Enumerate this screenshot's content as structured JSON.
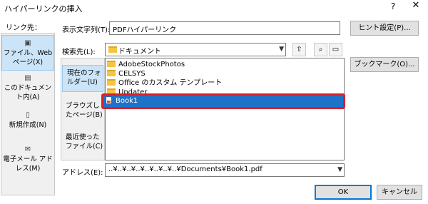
{
  "window": {
    "title": "ハイパーリンクの挿入",
    "help": "?",
    "close": "✕"
  },
  "link_to": {
    "label": "リンク先：",
    "items": [
      {
        "label": "ファイル、Web ページ(X)",
        "icon": "globe-file-icon",
        "selected": true
      },
      {
        "label": "このドキュメント内(A)",
        "icon": "document-anchor-icon",
        "selected": false
      },
      {
        "label": "新規作成(N)",
        "icon": "new-document-icon",
        "selected": false
      },
      {
        "label": "電子メール アドレス(M)",
        "icon": "email-icon",
        "selected": false
      }
    ]
  },
  "display_text": {
    "label": "表示文字列(T):",
    "value": "PDFハイパーリンク"
  },
  "screentip_button": "ヒント設定(P)...",
  "look_in": {
    "label": "検索先(L):",
    "value": "ドキュメント"
  },
  "bookmark_button": "ブックマーク(O)...",
  "tabs": [
    {
      "label": "現在のフォルダー(U)",
      "selected": true
    },
    {
      "label": "ブラウズしたページ(B)",
      "selected": false
    },
    {
      "label": "最近使ったファイル(C)",
      "selected": false
    }
  ],
  "files": [
    {
      "name": "AdobeStockPhotos",
      "type": "folder"
    },
    {
      "name": "CELSYS",
      "type": "folder"
    },
    {
      "name": "Office のカスタム テンプレート",
      "type": "folder"
    },
    {
      "name": "Updater",
      "type": "folder"
    }
  ],
  "selected_file": {
    "name": "Book1",
    "type": "pdf"
  },
  "address": {
    "label": "アドレス(E):",
    "value": "..¥..¥..¥..¥..¥..¥..¥..¥Documents¥Book1.pdf"
  },
  "ok_button": "OK",
  "cancel_button": "キャンセル",
  "colors": {
    "selection": "#1e73c9",
    "highlight_border": "#d9202a",
    "panel_selected": "#cce4f7"
  }
}
